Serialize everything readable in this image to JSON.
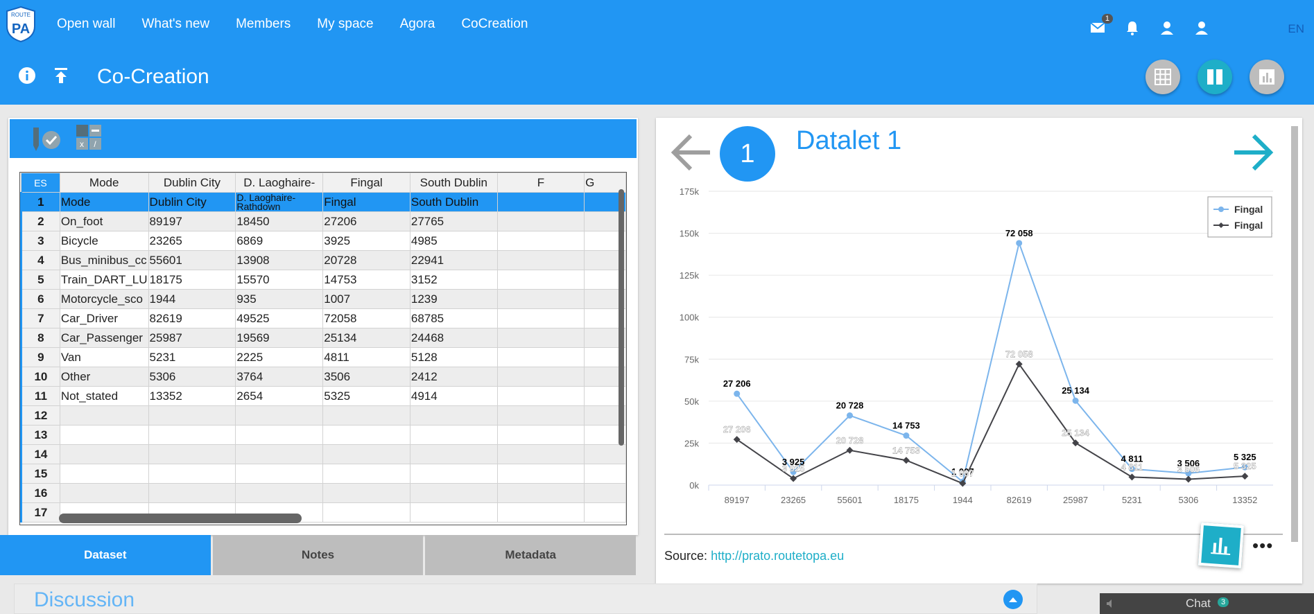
{
  "app": {
    "logo_text": "ROUTE TO PA",
    "language": "EN"
  },
  "nav": {
    "items": [
      "Open wall",
      "What's new",
      "Members",
      "My space",
      "Agora",
      "CoCreation"
    ]
  },
  "notifications": {
    "messages_count": "1"
  },
  "page": {
    "title": "Co-Creation"
  },
  "grid": {
    "corner": "ES",
    "columns": [
      "Mode",
      "Dublin City",
      "D. Laoghaire-",
      "Fingal",
      "South Dublin",
      "F",
      "G"
    ],
    "header_row": [
      "Mode",
      "Dublin City",
      "D. Laoghaire-Rathdown",
      "Fingal",
      "South Dublin"
    ],
    "rows": [
      [
        "On_foot",
        "89197",
        "18450",
        "27206",
        "27765"
      ],
      [
        "Bicycle",
        "23265",
        "6869",
        "3925",
        "4985"
      ],
      [
        "Bus_minibus_cc",
        "55601",
        "13908",
        "20728",
        "22941"
      ],
      [
        "Train_DART_LU",
        "18175",
        "15570",
        "14753",
        "3152"
      ],
      [
        "Motorcycle_sco",
        "1944",
        "935",
        "1007",
        "1239"
      ],
      [
        "Car_Driver",
        "82619",
        "49525",
        "72058",
        "68785"
      ],
      [
        "Car_Passenger",
        "25987",
        "19569",
        "25134",
        "24468"
      ],
      [
        "Van",
        "5231",
        "2225",
        "4811",
        "5128"
      ],
      [
        "Other",
        "5306",
        "3764",
        "3506",
        "2412"
      ],
      [
        "Not_stated",
        "13352",
        "2654",
        "5325",
        "4914"
      ]
    ],
    "row_numbers": [
      "1",
      "2",
      "3",
      "4",
      "5",
      "6",
      "7",
      "8",
      "9",
      "10",
      "11",
      "12",
      "13",
      "14",
      "15",
      "16",
      "17"
    ]
  },
  "tabs": {
    "dataset": "Dataset",
    "notes": "Notes",
    "metadata": "Metadata"
  },
  "datalet": {
    "number": "1",
    "title": "Datalet 1",
    "source_label": "Source:",
    "source_url": "http://prato.routetopa.eu"
  },
  "chart_data": {
    "type": "line",
    "categories": [
      "89197",
      "23265",
      "55601",
      "18175",
      "1944",
      "82619",
      "25987",
      "5231",
      "5306",
      "13352"
    ],
    "series": [
      {
        "name": "Fingal",
        "color": "#7cb5ec",
        "values": [
          54412,
          7850,
          41456,
          29506,
          2014,
          144116,
          50268,
          9622,
          7012,
          10650
        ]
      },
      {
        "name": "Fingal",
        "color": "#434348",
        "values": [
          27206,
          3925,
          20728,
          14753,
          1007,
          72058,
          25134,
          4811,
          3506,
          5325
        ]
      }
    ],
    "data_labels": [
      "27 206",
      "3 925",
      "20 728",
      "14 753",
      "1 007",
      "72 058",
      "25 134",
      "4 811",
      "3 506",
      "5 325"
    ],
    "y_ticks": [
      "0k",
      "25k",
      "50k",
      "75k",
      "100k",
      "125k",
      "150k",
      "175k"
    ],
    "ylim": [
      0,
      175000
    ],
    "legend_position": "top-right",
    "grid": true
  },
  "discussion": {
    "title": "Discussion"
  },
  "chat": {
    "label": "Chat",
    "count": "3"
  }
}
